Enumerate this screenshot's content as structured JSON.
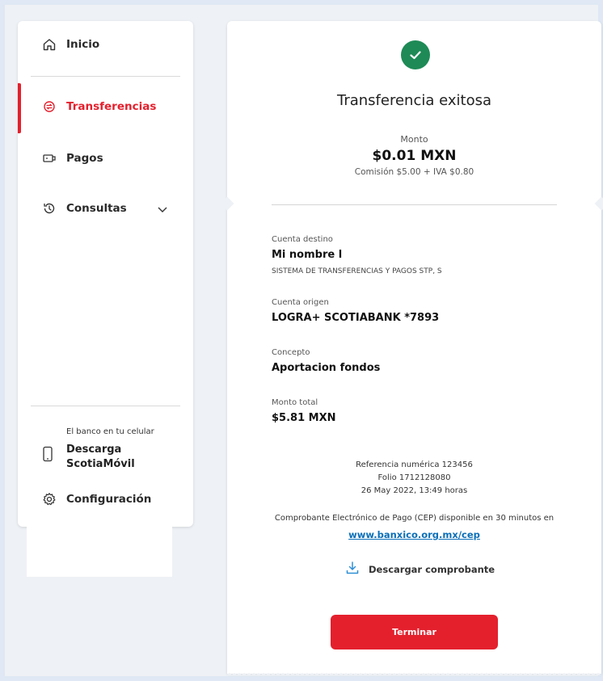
{
  "sidebar": {
    "items": [
      {
        "label": "Inicio",
        "icon": "home-icon"
      },
      {
        "label": "Transferencias",
        "icon": "transfer-icon",
        "active": true
      },
      {
        "label": "Pagos",
        "icon": "payments-icon"
      },
      {
        "label": "Consultas",
        "icon": "history-icon",
        "expandable": true
      }
    ],
    "promo_small": "El banco en tu celular",
    "promo_line1": "Descarga",
    "promo_line2": "ScotiaMóvil",
    "settings_label": "Configuración"
  },
  "receipt": {
    "title": "Transferencia exitosa",
    "monto_label": "Monto",
    "monto_value": "$0.01 MXN",
    "comision": "Comisión $5.00 + IVA $0.80",
    "destino_label": "Cuenta destino",
    "destino_name": "Mi nombre l",
    "destino_bank": "SISTEMA DE TRANSFERENCIAS Y PAGOS STP, S",
    "origen_label": "Cuenta origen",
    "origen_value": "LOGRA+ SCOTIABANK *7893",
    "concepto_label": "Concepto",
    "concepto_value": "Aportacion fondos",
    "total_label": "Monto total",
    "total_value": "$5.81 MXN",
    "referencia": "Referencia numérica 123456",
    "folio": "Folio 1712128080",
    "fecha": "26 May 2022, 13:49 horas",
    "cep_text": "Comprobante Electrónico de Pago (CEP) disponible en 30 minutos en",
    "cep_link": "www.banxico.org.mx/cep",
    "download_label": "Descargar comprobante",
    "finish_button": "Terminar"
  },
  "colors": {
    "accent": "#e4202d",
    "success": "#1e8a56",
    "link": "#0b6fb8"
  }
}
